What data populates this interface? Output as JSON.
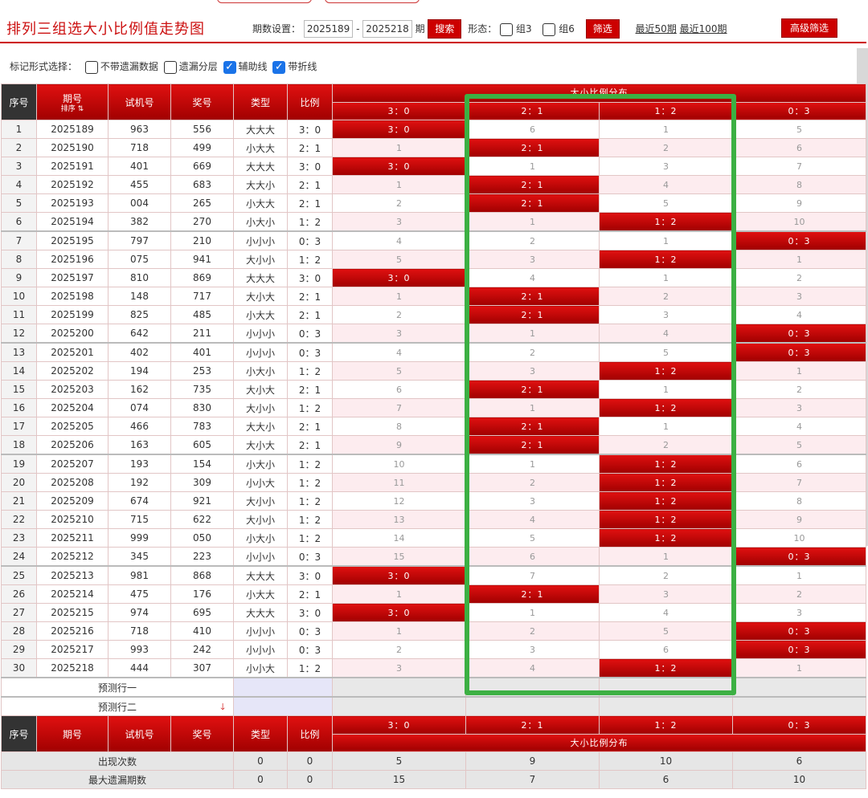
{
  "title": "排列三组选大小比例值走势图",
  "controls": {
    "period_label": "期数设置：",
    "from": "2025189",
    "dash": "-",
    "to": "2025218",
    "period_unit": "期",
    "search": "搜索",
    "form_label": "形态：",
    "group3": "组3",
    "group6": "组6",
    "filter": "筛选",
    "last50": "最近50期",
    "last100": "最近100期",
    "advanced": "高级筛选"
  },
  "marks": {
    "label": "标记形式选择：",
    "opt1": "不带遗漏数据",
    "opt2": "遗漏分层",
    "opt3": "辅助线",
    "opt4": "带折线"
  },
  "header": {
    "seq": "序号",
    "period": "期号",
    "sort": "排序",
    "trial": "试机号",
    "award": "奖号",
    "type": "类型",
    "ratio": "比例",
    "dist_title": "大小比例分布",
    "cols": [
      "3：0",
      "2：1",
      "1：2",
      "0：3"
    ]
  },
  "rows": [
    {
      "seq": "1",
      "period": "2025189",
      "trial": "963",
      "award": "556",
      "type": "大大大",
      "ratio": "3：0",
      "cells": [
        "3：0",
        "6",
        "1",
        "5"
      ],
      "hit": 0
    },
    {
      "seq": "2",
      "period": "2025190",
      "trial": "718",
      "award": "499",
      "type": "小大大",
      "ratio": "2：1",
      "cells": [
        "1",
        "2：1",
        "2",
        "6"
      ],
      "hit": 1
    },
    {
      "seq": "3",
      "period": "2025191",
      "trial": "401",
      "award": "669",
      "type": "大大大",
      "ratio": "3：0",
      "cells": [
        "3：0",
        "1",
        "3",
        "7"
      ],
      "hit": 0
    },
    {
      "seq": "4",
      "period": "2025192",
      "trial": "455",
      "award": "683",
      "type": "大大小",
      "ratio": "2：1",
      "cells": [
        "1",
        "2：1",
        "4",
        "8"
      ],
      "hit": 1
    },
    {
      "seq": "5",
      "period": "2025193",
      "trial": "004",
      "award": "265",
      "type": "小大大",
      "ratio": "2：1",
      "cells": [
        "2",
        "2：1",
        "5",
        "9"
      ],
      "hit": 1
    },
    {
      "seq": "6",
      "period": "2025194",
      "trial": "382",
      "award": "270",
      "type": "小大小",
      "ratio": "1：2",
      "cells": [
        "3",
        "1",
        "1：2",
        "10"
      ],
      "hit": 2
    },
    {
      "seq": "7",
      "period": "2025195",
      "trial": "797",
      "award": "210",
      "type": "小小小",
      "ratio": "0：3",
      "cells": [
        "4",
        "2",
        "1",
        "0：3"
      ],
      "hit": 3
    },
    {
      "seq": "8",
      "period": "2025196",
      "trial": "075",
      "award": "941",
      "type": "大小小",
      "ratio": "1：2",
      "cells": [
        "5",
        "3",
        "1：2",
        "1"
      ],
      "hit": 2
    },
    {
      "seq": "9",
      "period": "2025197",
      "trial": "810",
      "award": "869",
      "type": "大大大",
      "ratio": "3：0",
      "cells": [
        "3：0",
        "4",
        "1",
        "2"
      ],
      "hit": 0
    },
    {
      "seq": "10",
      "period": "2025198",
      "trial": "148",
      "award": "717",
      "type": "大小大",
      "ratio": "2：1",
      "cells": [
        "1",
        "2：1",
        "2",
        "3"
      ],
      "hit": 1
    },
    {
      "seq": "11",
      "period": "2025199",
      "trial": "825",
      "award": "485",
      "type": "小大大",
      "ratio": "2：1",
      "cells": [
        "2",
        "2：1",
        "3",
        "4"
      ],
      "hit": 1
    },
    {
      "seq": "12",
      "period": "2025200",
      "trial": "642",
      "award": "211",
      "type": "小小小",
      "ratio": "0：3",
      "cells": [
        "3",
        "1",
        "4",
        "0：3"
      ],
      "hit": 3
    },
    {
      "seq": "13",
      "period": "2025201",
      "trial": "402",
      "award": "401",
      "type": "小小小",
      "ratio": "0：3",
      "cells": [
        "4",
        "2",
        "5",
        "0：3"
      ],
      "hit": 3
    },
    {
      "seq": "14",
      "period": "2025202",
      "trial": "194",
      "award": "253",
      "type": "小大小",
      "ratio": "1：2",
      "cells": [
        "5",
        "3",
        "1：2",
        "1"
      ],
      "hit": 2
    },
    {
      "seq": "15",
      "period": "2025203",
      "trial": "162",
      "award": "735",
      "type": "大小大",
      "ratio": "2：1",
      "cells": [
        "6",
        "2：1",
        "1",
        "2"
      ],
      "hit": 1
    },
    {
      "seq": "16",
      "period": "2025204",
      "trial": "074",
      "award": "830",
      "type": "大小小",
      "ratio": "1：2",
      "cells": [
        "7",
        "1",
        "1：2",
        "3"
      ],
      "hit": 2
    },
    {
      "seq": "17",
      "period": "2025205",
      "trial": "466",
      "award": "783",
      "type": "大大小",
      "ratio": "2：1",
      "cells": [
        "8",
        "2：1",
        "1",
        "4"
      ],
      "hit": 1
    },
    {
      "seq": "18",
      "period": "2025206",
      "trial": "163",
      "award": "605",
      "type": "大小大",
      "ratio": "2：1",
      "cells": [
        "9",
        "2：1",
        "2",
        "5"
      ],
      "hit": 1
    },
    {
      "seq": "19",
      "period": "2025207",
      "trial": "193",
      "award": "154",
      "type": "小大小",
      "ratio": "1：2",
      "cells": [
        "10",
        "1",
        "1：2",
        "6"
      ],
      "hit": 2
    },
    {
      "seq": "20",
      "period": "2025208",
      "trial": "192",
      "award": "309",
      "type": "小小大",
      "ratio": "1：2",
      "cells": [
        "11",
        "2",
        "1：2",
        "7"
      ],
      "hit": 2
    },
    {
      "seq": "21",
      "period": "2025209",
      "trial": "674",
      "award": "921",
      "type": "大小小",
      "ratio": "1：2",
      "cells": [
        "12",
        "3",
        "1：2",
        "8"
      ],
      "hit": 2
    },
    {
      "seq": "22",
      "period": "2025210",
      "trial": "715",
      "award": "622",
      "type": "大小小",
      "ratio": "1：2",
      "cells": [
        "13",
        "4",
        "1：2",
        "9"
      ],
      "hit": 2
    },
    {
      "seq": "23",
      "period": "2025211",
      "trial": "999",
      "award": "050",
      "type": "小大小",
      "ratio": "1：2",
      "cells": [
        "14",
        "5",
        "1：2",
        "10"
      ],
      "hit": 2
    },
    {
      "seq": "24",
      "period": "2025212",
      "trial": "345",
      "award": "223",
      "type": "小小小",
      "ratio": "0：3",
      "cells": [
        "15",
        "6",
        "1",
        "0：3"
      ],
      "hit": 3
    },
    {
      "seq": "25",
      "period": "2025213",
      "trial": "981",
      "award": "868",
      "type": "大大大",
      "ratio": "3：0",
      "cells": [
        "3：0",
        "7",
        "2",
        "1"
      ],
      "hit": 0
    },
    {
      "seq": "26",
      "period": "2025214",
      "trial": "475",
      "award": "176",
      "type": "小大大",
      "ratio": "2：1",
      "cells": [
        "1",
        "2：1",
        "3",
        "2"
      ],
      "hit": 1
    },
    {
      "seq": "27",
      "period": "2025215",
      "trial": "974",
      "award": "695",
      "type": "大大大",
      "ratio": "3：0",
      "cells": [
        "3：0",
        "1",
        "4",
        "3"
      ],
      "hit": 0
    },
    {
      "seq": "28",
      "period": "2025216",
      "trial": "718",
      "award": "410",
      "type": "小小小",
      "ratio": "0：3",
      "cells": [
        "1",
        "2",
        "5",
        "0：3"
      ],
      "hit": 3
    },
    {
      "seq": "29",
      "period": "2025217",
      "trial": "993",
      "award": "242",
      "type": "小小小",
      "ratio": "0：3",
      "cells": [
        "2",
        "3",
        "6",
        "0：3"
      ],
      "hit": 3
    },
    {
      "seq": "30",
      "period": "2025218",
      "trial": "444",
      "award": "307",
      "type": "小小大",
      "ratio": "1：2",
      "cells": [
        "3",
        "4",
        "1：2",
        "1"
      ],
      "hit": 2
    }
  ],
  "predict": {
    "row1": "预测行一",
    "row2": "预测行二"
  },
  "stats": [
    {
      "label": "出现次数",
      "type": "0",
      "ratio": "0",
      "cells": [
        "5",
        "9",
        "10",
        "6"
      ]
    },
    {
      "label": "最大遗漏期数",
      "type": "0",
      "ratio": "0",
      "cells": [
        "15",
        "7",
        "6",
        "10"
      ]
    }
  ],
  "colors": {
    "accent": "#cc0000",
    "highlight_box": "#3cb043",
    "checkbox": "#1a73e8"
  }
}
